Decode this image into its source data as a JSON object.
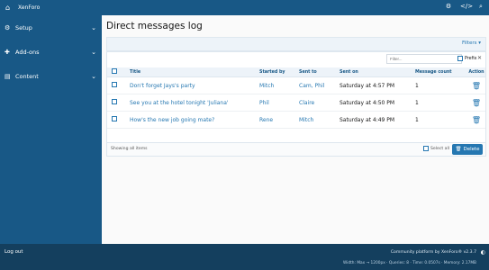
{
  "app": {
    "name": "XenForo",
    "icons": [
      "home-icon",
      "admin-tools-icon",
      "code-icon",
      "search-icon"
    ]
  },
  "sidebar": {
    "items": [
      {
        "label": "Setup",
        "icon": "gear-icon"
      },
      {
        "label": "Add-ons",
        "icon": "puzzle-icon"
      },
      {
        "label": "Content",
        "icon": "content-icon"
      }
    ]
  },
  "page": {
    "title": "Direct messages log",
    "filters_label": "Filters",
    "filter_placeholder": "Filter...",
    "prefix_label": "Prefix"
  },
  "table": {
    "headers": {
      "title": "Title",
      "started_by": "Started by",
      "sent_to": "Sent to",
      "sent_on": "Sent on",
      "count": "Message count",
      "action": "Action"
    },
    "rows": [
      {
        "title": "Don't forget Jays's party",
        "started_by": "Mitch",
        "sent_to": "Cam, Phil",
        "sent_on": "Saturday at 4:57 PM",
        "count": "1"
      },
      {
        "title": "See you at the hotel tonight 'Juliana'",
        "started_by": "Phil",
        "sent_to": "Claire",
        "sent_on": "Saturday at 4:50 PM",
        "count": "1"
      },
      {
        "title": "How's the new job going mate?",
        "started_by": "Rene",
        "sent_to": "Mitch",
        "sent_on": "Saturday at 4:49 PM",
        "count": "1"
      }
    ]
  },
  "footer_block": {
    "showing": "Showing all items",
    "select_all": "Select all",
    "delete": "Delete"
  },
  "footer": {
    "logout": "Log out",
    "credit": "Community platform by XenForo® v2.3.7",
    "stats": "Width: Max → 1200px · Queries: 8 · Time: 0.0507s · Memory: 2.17MB"
  },
  "colors": {
    "brand": "#185886",
    "accent": "#2577b1",
    "footer": "#143f5e"
  }
}
